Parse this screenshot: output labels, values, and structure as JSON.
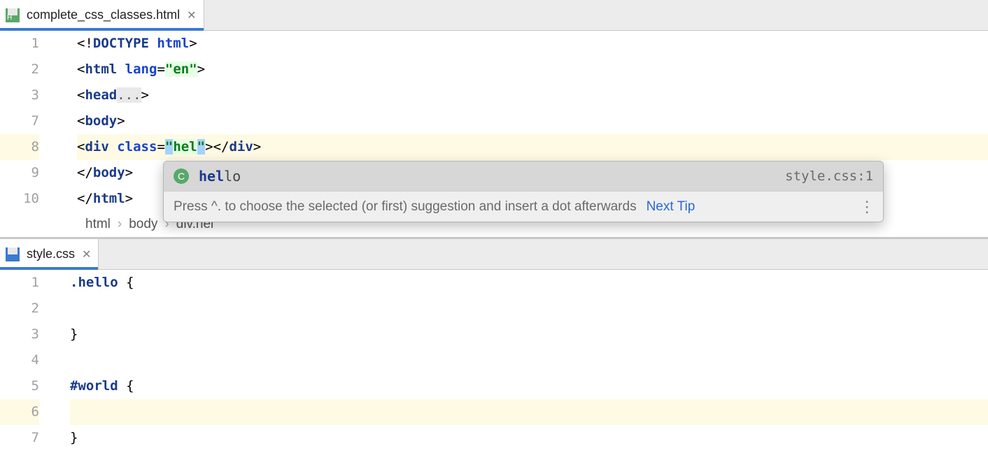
{
  "tabs": {
    "top": {
      "filename": "complete_css_classes.html"
    },
    "bottom": {
      "filename": "style.css"
    }
  },
  "editor_html": {
    "line_numbers": [
      "1",
      "2",
      "3",
      "7",
      "8",
      "9",
      "10"
    ],
    "l1": {
      "a": "<!",
      "b": "DOCTYPE",
      "c": " ",
      "d": "html",
      "e": ">"
    },
    "l2": {
      "a": "<",
      "b": "html",
      "c": " ",
      "d": "lang",
      "e": "=",
      "f": "\"en\"",
      "g": ">"
    },
    "l3": {
      "a": "<",
      "b": "head",
      "c": "...",
      "d": ">"
    },
    "l7": {
      "a": "<",
      "b": "body",
      "c": ">"
    },
    "l8": {
      "a": "<",
      "b": "div",
      "c": " ",
      "d": "class",
      "e": "=",
      "f": "\"",
      "g": "hel",
      "h": "\"",
      "i": ">",
      "j": "</",
      "k": "div",
      "l": ">"
    },
    "l9": {
      "a": "</",
      "b": "body",
      "c": ">"
    },
    "l10": {
      "a": "</",
      "b": "html",
      "c": ">"
    }
  },
  "popup": {
    "badge": "C",
    "match_prefix": "hel",
    "match_rest": "lo",
    "source": "style.css:1",
    "hint": "Press ^. to choose the selected (or first) suggestion and insert a dot afterwards",
    "link": "Next Tip"
  },
  "breadcrumb": {
    "a": "html",
    "b": "body",
    "c": "div.hel"
  },
  "editor_css": {
    "line_numbers": [
      "1",
      "2",
      "3",
      "4",
      "5",
      "6",
      "7"
    ],
    "l1": {
      "a": ".hello",
      "b": " {"
    },
    "l3": {
      "a": "}"
    },
    "l5": {
      "a": "#world",
      "b": " {"
    },
    "l7": {
      "a": "}"
    }
  }
}
